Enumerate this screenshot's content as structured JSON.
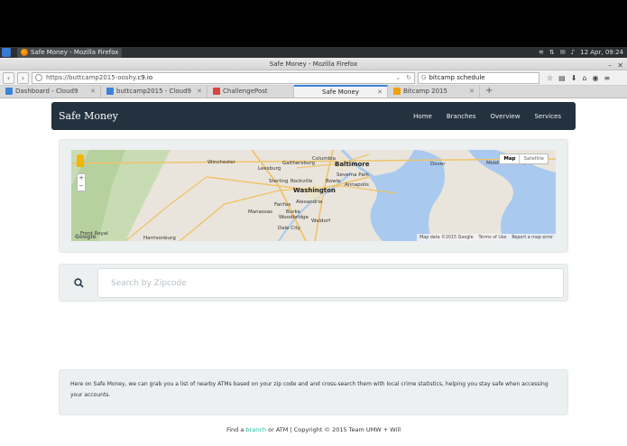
{
  "os_panel": {
    "task_title": "Safe Money - Mozilla Firefox",
    "clock": "12 Apr, 09:24"
  },
  "window": {
    "title": "Safe Money - Mozilla Firefox"
  },
  "nav_bar": {
    "url_prefix": "https://buttcamp2015-ooshy.",
    "url_host": "c9.io",
    "search_value": "bitcamp schedule"
  },
  "tabs": [
    {
      "label": "Dashboard - Cloud9",
      "favicon_color": "#3b83d9"
    },
    {
      "label": "buttcamp2015 - Cloud9",
      "favicon_color": "#3b83d9"
    },
    {
      "label": "ChallengePost",
      "favicon_color": "#d9453b"
    },
    {
      "label": "Safe Money",
      "favicon_color": "",
      "active": true
    },
    {
      "label": "Bitcamp 2015",
      "favicon_color": "#f0a30a"
    }
  ],
  "app": {
    "brand": "Safe Money",
    "nav": [
      "Home",
      "Branches",
      "Overview",
      "Services"
    ],
    "nav_bg": "#243240"
  },
  "map": {
    "type_buttons": [
      "Map",
      "Satellite"
    ],
    "labels": {
      "winchester": "Winchester",
      "leesburg": "Leesburg",
      "gaithersburg": "Gaithersburg",
      "columbia": "Columbia",
      "baltimore": "Baltimore",
      "severna_park": "Severna Park",
      "sterling": "Sterling",
      "rockville": "Rockville",
      "bowie": "Bowie",
      "annapolis": "Annapolis",
      "washington": "Washington",
      "alexandria": "Alexandria",
      "manassas": "Manassas",
      "fairfax": "Fairfax",
      "burke": "Burke",
      "woodbridge": "Woodbridge",
      "waldorf": "Waldorf",
      "dale_city": "Dale City",
      "dover": "Dover",
      "middletown": "Middle Township",
      "harrisonburg": "Harrisonburg",
      "front_royal": "Front Royal"
    },
    "footer": {
      "data": "Map data ©2015 Google",
      "terms": "Terms of Use",
      "report": "Report a map error"
    },
    "logo": "Google"
  },
  "search": {
    "placeholder": "Search by Zipcode",
    "value": ""
  },
  "info": {
    "text": "Here on Safe Money, we can grab you a list of nearby ATMs based on your zip code and and cross-search them with local crime statistics, helping you stay safe when accessing your accounts."
  },
  "footer": {
    "prefix": "Find a",
    "link": "branch",
    "suffix": "or ATM | Copyright © 2015 Team UMW + Will"
  }
}
